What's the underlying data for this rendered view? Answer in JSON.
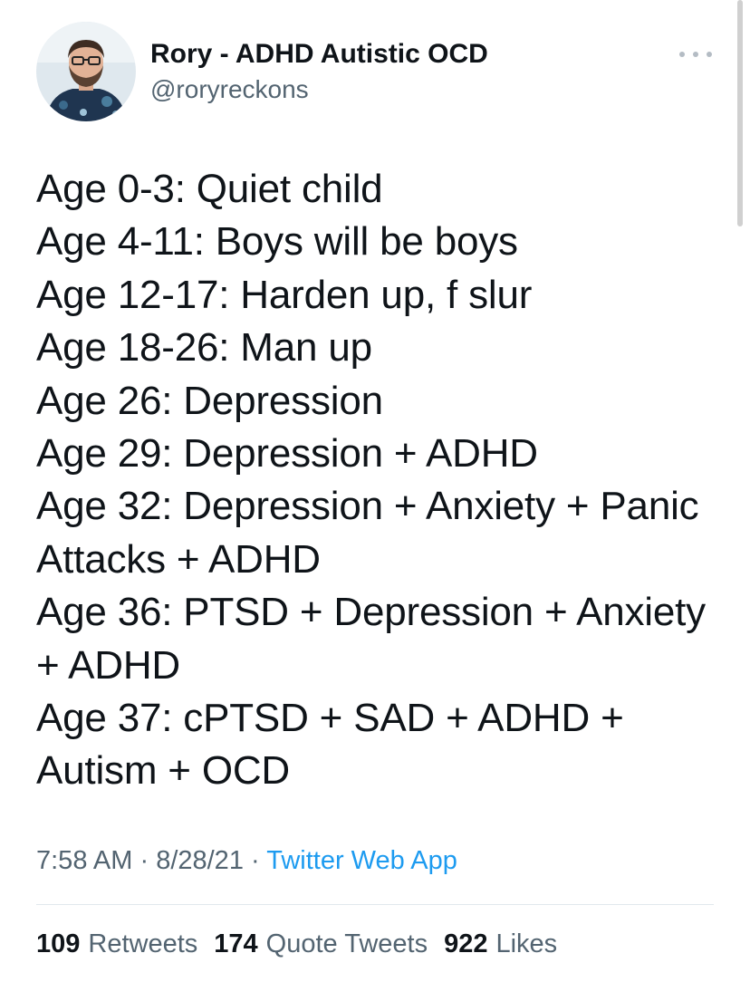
{
  "author": {
    "name": "Rory - ADHD Autistic OCD",
    "handle": "@roryreckons",
    "avatar_icon": "profile-photo"
  },
  "tweet": {
    "lines": [
      "Age 0-3: Quiet child",
      "Age 4-11: Boys will be boys",
      "Age 12-17: Harden up, f slur",
      "Age 18-26: Man up",
      "Age 26: Depression",
      "Age 29: Depression + ADHD",
      "Age 32: Depression + Anxiety + Panic",
      "Attacks + ADHD",
      "Age 36: PTSD + Depression + Anxiety",
      "+ ADHD",
      "Age 37: cPTSD + SAD + ADHD +",
      "Autism + OCD"
    ]
  },
  "meta": {
    "time": "7:58 AM",
    "separator": "·",
    "date": "8/28/21",
    "source": "Twitter Web App"
  },
  "stats": {
    "retweets_count": "109",
    "retweets_label": "Retweets",
    "quotes_count": "174",
    "quotes_label": "Quote Tweets",
    "likes_count": "922",
    "likes_label": "Likes"
  },
  "colors": {
    "text": "#0f1419",
    "secondary": "#536471",
    "link": "#1d9bf0",
    "divider": "#e1e8ed"
  }
}
